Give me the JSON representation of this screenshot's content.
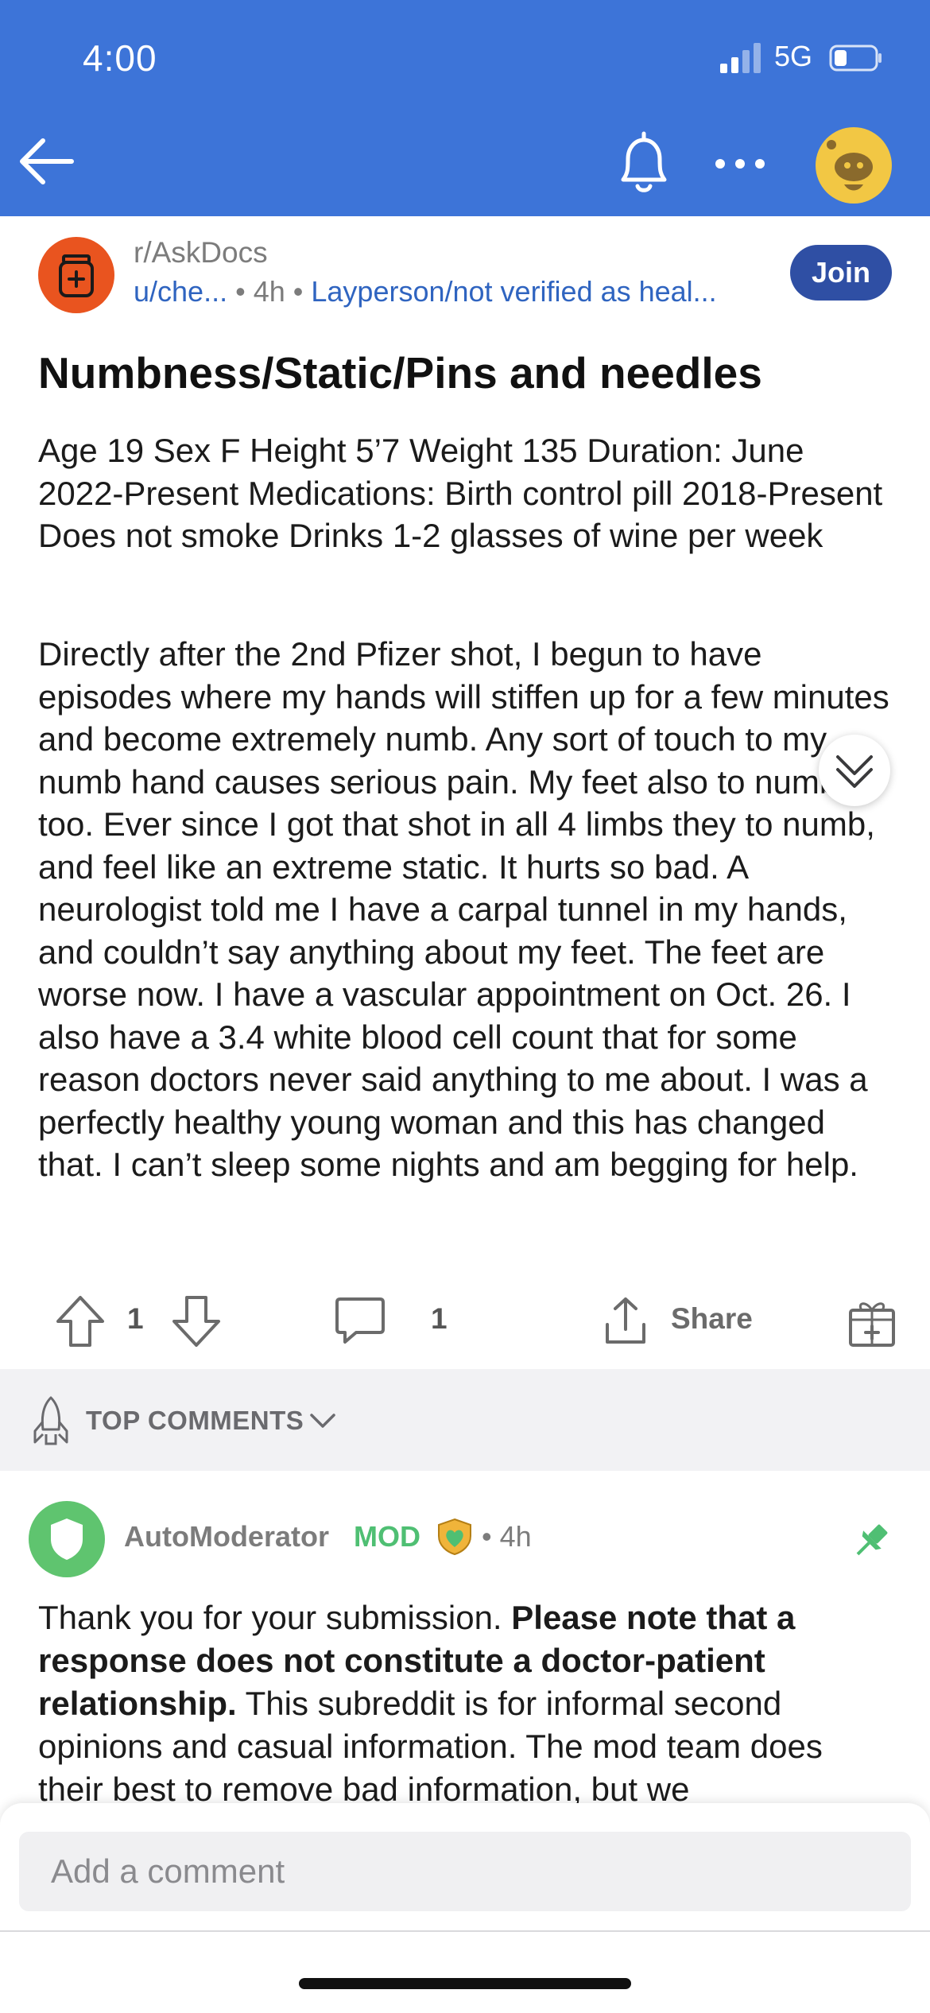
{
  "status_bar": {
    "time": "4:00",
    "network": "5G"
  },
  "nav": {
    "back_icon": "arrow-left-icon",
    "bell_icon": "bell-icon",
    "more_icon": "more-dots-icon",
    "avatar_icon": "user-avatar"
  },
  "colors": {
    "header": "#3d74d8",
    "join": "#2f4fa4",
    "subreddit_icon": "#e9541f",
    "mod_green": "#4fbf73",
    "link_blue": "#2f64c0"
  },
  "post": {
    "subreddit": "r/AskDocs",
    "author": "u/che...",
    "age": "4h",
    "flair": "Layperson/not verified as heal...",
    "join_label": "Join",
    "title": "Numbness/Static/Pins and needles",
    "paragraphs": [
      "Age 19 Sex F Height 5’7 Weight 135 Duration: June 2022-Present Medications: Birth control pill 2018-Present Does not smoke Drinks 1-2 glasses of wine per week",
      "Directly after the 2nd Pfizer shot, I begun to have episodes where my hands will stiffen up for a few minutes and become extremely numb. Any sort of touch to my numb hand causes serious pain. My feet also to numb too. Ever since I got that shot in all 4 limbs they to numb, and feel like an extreme static. It hurts so bad. A neurologist told me I have a carpal tunnel in my hands, and couldn’t say anything about my feet. The feet are worse now. I have a vascular appointment on Oct. 26. I also have a 3.4 white blood cell count that for some reason doctors never said anything to me about. I was a perfectly healthy young woman and this has changed that. I can’t sleep some nights and am begging for help."
    ],
    "votes": "1",
    "comments": "1",
    "share_label": "Share"
  },
  "sort": {
    "label": "TOP COMMENTS"
  },
  "comment": {
    "author": "AutoModerator",
    "badge": "MOD",
    "age": "4h",
    "text_start": "Thank you for your submission. ",
    "text_bold": "Please note that a response does not constitute a doctor-patient relationship.",
    "text_end": " This subreddit is for informal second opinions and casual information. The mod team does their best to remove bad information, but we"
  },
  "composer": {
    "placeholder": "Add a comment"
  }
}
